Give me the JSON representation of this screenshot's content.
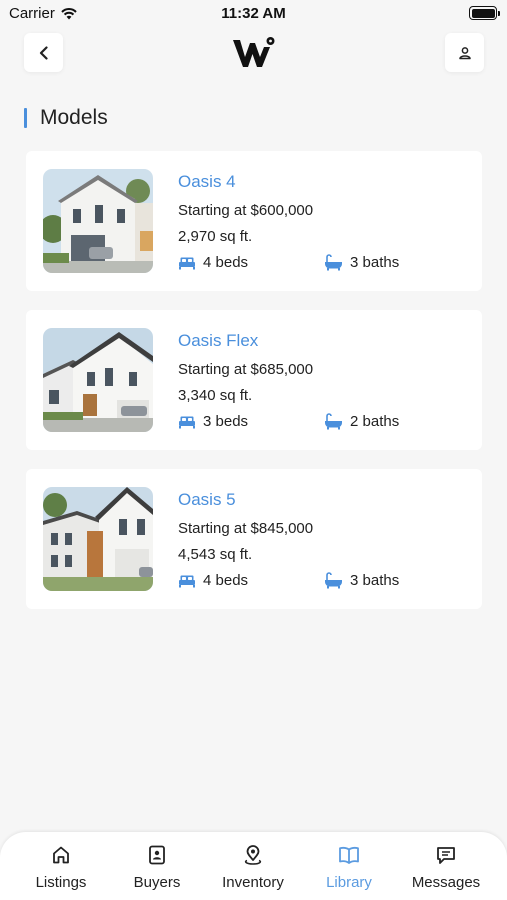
{
  "status_bar": {
    "carrier": "Carrier",
    "time": "11:32 AM"
  },
  "header": {
    "title": "Models"
  },
  "colors": {
    "accent": "#4a8fdc",
    "active_tab": "#5b9be0"
  },
  "models": [
    {
      "name": "Oasis 4",
      "price": "Starting at $600,000",
      "size": "2,970 sq ft.",
      "beds": "4 beds",
      "baths": "3 baths"
    },
    {
      "name": "Oasis Flex",
      "price": "Starting at $685,000",
      "size": "3,340 sq ft.",
      "beds": "3 beds",
      "baths": "2 baths"
    },
    {
      "name": "Oasis 5",
      "price": "Starting at $845,000",
      "size": "4,543 sq ft.",
      "beds": "4 beds",
      "baths": "3 baths"
    }
  ],
  "tabs": [
    {
      "label": "Listings",
      "icon": "home-icon"
    },
    {
      "label": "Buyers",
      "icon": "contact-card-icon"
    },
    {
      "label": "Inventory",
      "icon": "map-pin-icon"
    },
    {
      "label": "Library",
      "icon": "open-book-icon",
      "active": true
    },
    {
      "label": "Messages",
      "icon": "chat-bubble-icon"
    }
  ]
}
